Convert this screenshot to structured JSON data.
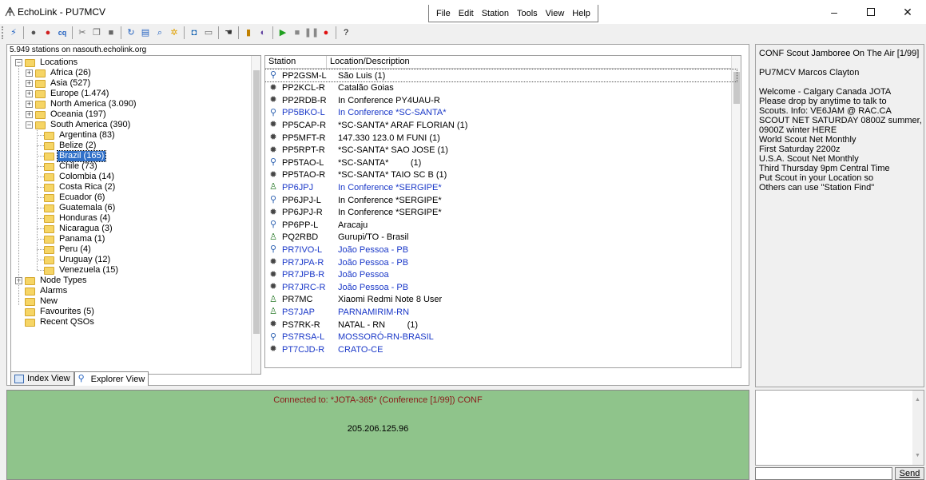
{
  "window": {
    "title": "EchoLink - PU7MCV"
  },
  "menu": [
    "File",
    "Edit",
    "Station",
    "Tools",
    "View",
    "Help"
  ],
  "toolbar": {
    "buttons": [
      {
        "name": "connect-icon",
        "glyph": "⚡",
        "color": "#2060c0"
      },
      {
        "name": "sep"
      },
      {
        "name": "conference-icon",
        "glyph": "●",
        "color": "#555"
      },
      {
        "name": "disconnect-icon",
        "glyph": "●",
        "color": "#d02020"
      },
      {
        "name": "cq-icon",
        "glyph": "cq",
        "color": "#2060c0"
      },
      {
        "name": "sep"
      },
      {
        "name": "cut-icon",
        "glyph": "✂",
        "color": "#666"
      },
      {
        "name": "copy-icon",
        "glyph": "❐",
        "color": "#666"
      },
      {
        "name": "delete-icon",
        "glyph": "■",
        "color": "#666"
      },
      {
        "name": "sep"
      },
      {
        "name": "refresh-icon",
        "glyph": "↻",
        "color": "#2060c0"
      },
      {
        "name": "chat-icon",
        "glyph": "▤",
        "color": "#2060c0"
      },
      {
        "name": "find-icon",
        "glyph": "⌕",
        "color": "#2060c0"
      },
      {
        "name": "alert-icon",
        "glyph": "✲",
        "color": "#e0a000"
      },
      {
        "name": "sep"
      },
      {
        "name": "sysop-icon",
        "glyph": "◘",
        "color": "#1060b0"
      },
      {
        "name": "info-icon",
        "glyph": "▭",
        "color": "#666"
      },
      {
        "name": "sep"
      },
      {
        "name": "hand-icon",
        "glyph": "☚",
        "color": "#333"
      },
      {
        "name": "sep"
      },
      {
        "name": "stats-icon",
        "glyph": "▮",
        "color": "#c08000"
      },
      {
        "name": "properties-icon",
        "glyph": "◐",
        "color": "#6040a0"
      },
      {
        "name": "sep"
      },
      {
        "name": "play-icon",
        "glyph": "▶",
        "color": "#20a020"
      },
      {
        "name": "stop-icon",
        "glyph": "■",
        "color": "#888"
      },
      {
        "name": "pause-icon",
        "glyph": "❚❚",
        "color": "#888"
      },
      {
        "name": "record-icon",
        "glyph": "●",
        "color": "#e01010"
      },
      {
        "name": "sep"
      },
      {
        "name": "help-icon",
        "glyph": "?",
        "color": "#000"
      }
    ]
  },
  "status": {
    "station_count": "5.949 stations on nasouth.echolink.org"
  },
  "tree": {
    "items": [
      {
        "label": "Locations",
        "level": 0,
        "expander": "−"
      },
      {
        "label": "Africa (26)",
        "level": 1,
        "expander": "+"
      },
      {
        "label": "Asia (527)",
        "level": 1,
        "expander": "+"
      },
      {
        "label": "Europe (1.474)",
        "level": 1,
        "expander": "+"
      },
      {
        "label": "North America (3.090)",
        "level": 1,
        "expander": "+"
      },
      {
        "label": "Oceania (197)",
        "level": 1,
        "expander": "+"
      },
      {
        "label": "South America (390)",
        "level": 1,
        "expander": "−"
      },
      {
        "label": "Argentina (83)",
        "level": 2
      },
      {
        "label": "Belize (2)",
        "level": 2
      },
      {
        "label": "Brazil (165)",
        "level": 2,
        "selected": true
      },
      {
        "label": "Chile (73)",
        "level": 2
      },
      {
        "label": "Colombia (14)",
        "level": 2
      },
      {
        "label": "Costa Rica (2)",
        "level": 2
      },
      {
        "label": "Ecuador (6)",
        "level": 2
      },
      {
        "label": "Guatemala (6)",
        "level": 2
      },
      {
        "label": "Honduras (4)",
        "level": 2
      },
      {
        "label": "Nicaragua (3)",
        "level": 2
      },
      {
        "label": "Panama (1)",
        "level": 2
      },
      {
        "label": "Peru (4)",
        "level": 2
      },
      {
        "label": "Uruguay (12)",
        "level": 2
      },
      {
        "label": "Venezuela (15)",
        "level": 2
      },
      {
        "label": "Node Types",
        "level": 0,
        "expander": "+"
      },
      {
        "label": "Alarms",
        "level": 0
      },
      {
        "label": "New",
        "level": 0
      },
      {
        "label": "Favourites (5)",
        "level": 0
      },
      {
        "label": "Recent QSOs",
        "level": 0
      }
    ]
  },
  "station_list": {
    "columns": [
      "Station",
      "Location/Description"
    ],
    "rows": [
      {
        "call": "PP2GSM-L",
        "desc": "São Luis (1)",
        "type": "link",
        "busy": false
      },
      {
        "call": "PP2KCL-R",
        "desc": "Catalão Goias",
        "type": "repeater",
        "busy": false
      },
      {
        "call": "PP2RDB-R",
        "desc": "In Conference PY4UAU-R",
        "type": "repeater",
        "busy": false
      },
      {
        "call": "PP5BKO-L",
        "desc": "In Conference *SC-SANTA*",
        "type": "link",
        "busy": true
      },
      {
        "call": "PP5CAP-R",
        "desc": "*SC-SANTA* ARAF FLORIAN (1)",
        "type": "repeater",
        "busy": false
      },
      {
        "call": "PP5MFT-R",
        "desc": "147.330 123.0 M FUNI (1)",
        "type": "repeater",
        "busy": false
      },
      {
        "call": "PP5RPT-R",
        "desc": "*SC-SANTA* SAO JOSE (1)",
        "type": "repeater",
        "busy": false
      },
      {
        "call": "PP5TAO-L",
        "desc": "*SC-SANTA*         (1)",
        "type": "link",
        "busy": false
      },
      {
        "call": "PP5TAO-R",
        "desc": "*SC-SANTA* TAIO SC B (1)",
        "type": "repeater",
        "busy": false
      },
      {
        "call": "PP6JPJ",
        "desc": "In Conference *SERGIPE*",
        "type": "user",
        "busy": true
      },
      {
        "call": "PP6JPJ-L",
        "desc": "In Conference *SERGIPE*",
        "type": "link",
        "busy": false
      },
      {
        "call": "PP6JPJ-R",
        "desc": "In Conference *SERGIPE*",
        "type": "repeater",
        "busy": false
      },
      {
        "call": "PP6PP-L",
        "desc": "Aracaju",
        "type": "link",
        "busy": false
      },
      {
        "call": "PQ2RBD",
        "desc": "Gurupi/TO - Brasil",
        "type": "user",
        "busy": false
      },
      {
        "call": "PR7IVO-L",
        "desc": "João Pessoa - PB",
        "type": "link",
        "busy": true
      },
      {
        "call": "PR7JPA-R",
        "desc": "João Pessoa - PB",
        "type": "repeater",
        "busy": true
      },
      {
        "call": "PR7JPB-R",
        "desc": "João Pessoa",
        "type": "repeater",
        "busy": true
      },
      {
        "call": "PR7JRC-R",
        "desc": "João Pessoa - PB",
        "type": "repeater",
        "busy": true
      },
      {
        "call": "PR7MC",
        "desc": "Xiaomi Redmi Note 8 User",
        "type": "user",
        "busy": false
      },
      {
        "call": "PS7JAP",
        "desc": "PARNAMIRIM-RN",
        "type": "user",
        "busy": true
      },
      {
        "call": "PS7RK-R",
        "desc": "NATAL - RN         (1)",
        "type": "repeater",
        "busy": false
      },
      {
        "call": "PS7RSA-L",
        "desc": "MOSSORÓ-RN-BRASIL",
        "type": "link",
        "busy": true
      },
      {
        "call": "PT7CJD-R",
        "desc": "CRATO-CE",
        "type": "repeater",
        "busy": true
      }
    ]
  },
  "tabs": [
    {
      "label": "Index View",
      "active": false
    },
    {
      "label": "Explorer View",
      "active": true
    }
  ],
  "info": {
    "lines": [
      "CONF Scout Jamboree On The Air [1/99]",
      "",
      "PU7MCV Marcos Clayton",
      "",
      "Welcome - Calgary Canada JOTA",
      "Please drop by anytime to talk to",
      "Scouts. Info: VE6JAM @ RAC.CA",
      "SCOUT NET SATURDAY 0800Z summer,",
      "0900Z winter HERE",
      "World Scout Net Monthly",
      "First Saturday 2200z",
      "U.S.A. Scout Net Monthly",
      "Third Thursday 9pm Central Time",
      "Put Scout in your Location so",
      "Others can use \"Station Find\""
    ]
  },
  "connection": {
    "status": "Connected to:  *JOTA-365* (Conference  [1/99]) CONF",
    "ip": "205.206.125.96"
  },
  "chat": {
    "send_label": "Send"
  },
  "colors": {
    "connected_bg": "#8fc48b",
    "connected_text": "#8b1a1a",
    "busy_station": "#1a38c8"
  }
}
